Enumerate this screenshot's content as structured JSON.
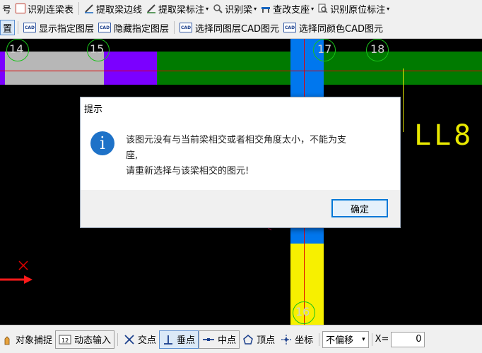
{
  "toolbar1": {
    "items": [
      {
        "label": "号"
      },
      {
        "label": "识别连梁表"
      },
      {
        "label": "提取梁边线"
      },
      {
        "label": "提取梁标注",
        "dropdown": true
      },
      {
        "label": "识别梁",
        "dropdown": true
      },
      {
        "label": "查改支座",
        "dropdown": true
      },
      {
        "label": "识别原位标注",
        "dropdown": true
      }
    ]
  },
  "toolbar2": {
    "items": [
      {
        "label": "置"
      },
      {
        "label": "显示指定图层",
        "icon_text": "CAD"
      },
      {
        "label": "隐藏指定图层",
        "icon_text": "CAD"
      },
      {
        "label": "选择同图层CAD图元",
        "icon_text": "CAD"
      },
      {
        "label": "选择同颜色CAD图元",
        "icon_text": "CAD"
      }
    ]
  },
  "canvas": {
    "axis_labels": [
      "14",
      "15",
      "17",
      "18",
      "16"
    ],
    "annotation_text": "LL8",
    "colors": {
      "gray": "#b7b7b7",
      "purple": "#7b00ff",
      "green": "#007a00",
      "blue": "#0077ee",
      "yellow": "#f7f000",
      "red": "#e00000",
      "annotation": "#e8e800"
    }
  },
  "dialog": {
    "title": "提示",
    "message_line1": "该图元没有与当前梁相交或者相交角度太小，不能为支",
    "message_line2": "座,",
    "message_line3": "请重新选择与该梁相交的图元!",
    "ok_label": "确定",
    "icon": "info-icon"
  },
  "statusbar": {
    "items": [
      {
        "label": "对象捕捉",
        "active": false
      },
      {
        "label": "动态输入",
        "active": false
      },
      {
        "label": "交点",
        "active": false
      },
      {
        "label": "垂点",
        "active": true
      },
      {
        "label": "中点",
        "active": false
      },
      {
        "label": "顶点",
        "active": false
      },
      {
        "label": "坐标",
        "active": false
      }
    ],
    "offset_select": "不偏移",
    "x_label": "X=",
    "x_value": "0"
  }
}
